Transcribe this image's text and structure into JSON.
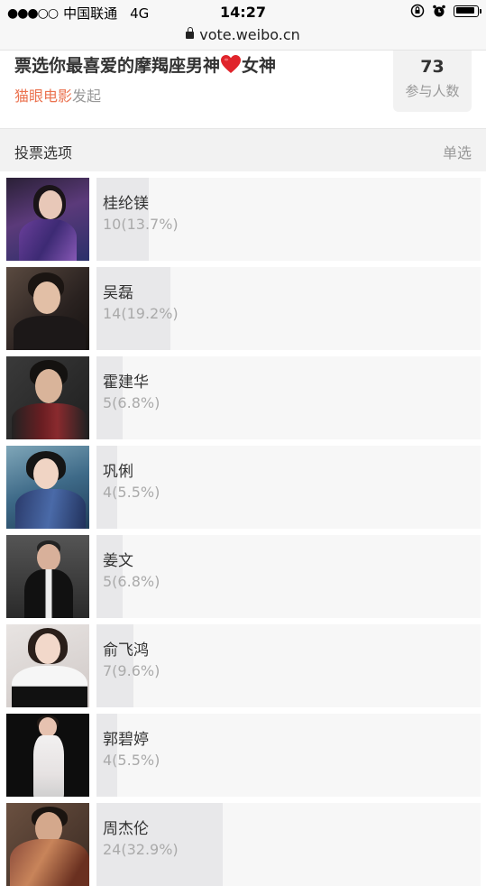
{
  "status_bar": {
    "signal": "●●●○○",
    "carrier": "中国联通",
    "network": "4G",
    "time": "14:27",
    "icons": [
      "rotation-lock-icon",
      "alarm-icon",
      "battery-icon"
    ]
  },
  "url_bar": {
    "url": "vote.weibo.cn",
    "icon": "lock-icon"
  },
  "poll": {
    "title_part1": "票选你最喜爱的摩羯座男神",
    "title_part2": "女神",
    "heart_icon": "heart-icon",
    "initiator_name": "猫眼电影",
    "initiator_suffix": "发起",
    "participant_count": "73",
    "participant_label": "参与人数"
  },
  "section": {
    "title": "投票选项",
    "mode": "单选"
  },
  "colors": {
    "accent_orange": "#eb7350",
    "bar_fill": "#e8e8ea",
    "bar_bg": "#f7f7f7",
    "heart_red": "#e0242b"
  },
  "options": [
    {
      "name": "桂纶镁",
      "stat": "10(13.7%)",
      "percent": 13.7
    },
    {
      "name": "吴磊",
      "stat": "14(19.2%)",
      "percent": 19.2
    },
    {
      "name": "霍建华",
      "stat": "5(6.8%)",
      "percent": 6.8
    },
    {
      "name": "巩俐",
      "stat": "4(5.5%)",
      "percent": 5.5
    },
    {
      "name": "姜文",
      "stat": "5(6.8%)",
      "percent": 6.8
    },
    {
      "name": "俞飞鸿",
      "stat": "7(9.6%)",
      "percent": 9.6
    },
    {
      "name": "郭碧婷",
      "stat": "4(5.5%)",
      "percent": 5.5
    },
    {
      "name": "周杰伦",
      "stat": "24(32.9%)",
      "percent": 32.9
    }
  ]
}
